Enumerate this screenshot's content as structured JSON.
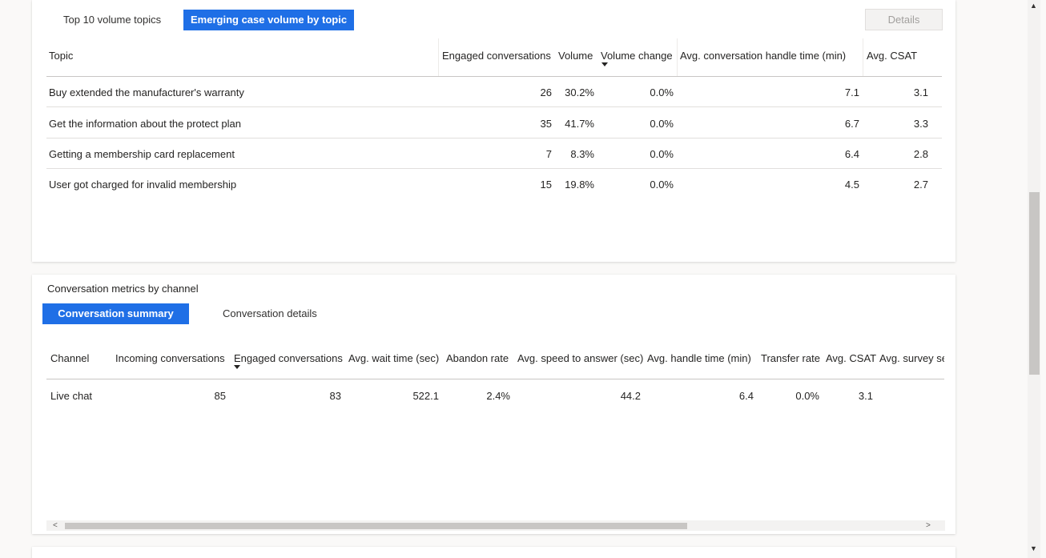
{
  "top_card": {
    "tabs": [
      "Top 10 volume topics",
      "Emerging case volume by topic"
    ],
    "details_label": "Details",
    "columns": [
      "Topic",
      "Engaged conversations",
      "Volume",
      "Volume change",
      "Avg. conversation handle time (min)",
      "Avg. CSAT"
    ],
    "rows": [
      [
        "Buy extended the manufacturer's warranty",
        "26",
        "30.2%",
        "0.0%",
        "7.1",
        "3.1"
      ],
      [
        "Get the information about the protect plan",
        "35",
        "41.7%",
        "0.0%",
        "6.7",
        "3.3"
      ],
      [
        "Getting a membership card replacement",
        "7",
        "8.3%",
        "0.0%",
        "6.4",
        "2.8"
      ],
      [
        "User got charged for invalid membership",
        "15",
        "19.8%",
        "0.0%",
        "4.5",
        "2.7"
      ]
    ]
  },
  "channel_card": {
    "title": "Conversation metrics by channel",
    "tabs": [
      "Conversation summary",
      "Conversation details"
    ],
    "columns": [
      "Channel",
      "Incoming conversations",
      "Engaged conversations",
      "Avg. wait time (sec)",
      "Abandon rate",
      "Avg. speed to answer (sec)",
      "Avg. handle time (min)",
      "Transfer rate",
      "Avg. CSAT",
      "Avg. survey se"
    ],
    "rows": [
      [
        "Live chat",
        "85",
        "83",
        "522.1",
        "2.4%",
        "44.2",
        "6.4",
        "0.0%",
        "3.1",
        ""
      ]
    ]
  },
  "scroll": {
    "left_arrow": "<",
    "right_arrow": ">",
    "up_arrow": "▲",
    "down_arrow": "▼"
  },
  "colors": {
    "accent": "#1f6fe6",
    "background": "#faf9f8"
  }
}
